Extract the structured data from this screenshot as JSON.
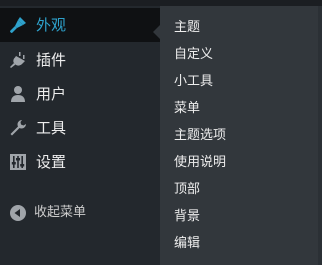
{
  "sidebar": {
    "items": [
      {
        "label": "外观",
        "icon": "paintbrush-icon",
        "current": true
      },
      {
        "label": "插件",
        "icon": "plugin-icon"
      },
      {
        "label": "用户",
        "icon": "user-icon"
      },
      {
        "label": "工具",
        "icon": "wrench-icon"
      },
      {
        "label": "设置",
        "icon": "sliders-icon"
      }
    ],
    "collapse": {
      "label": "收起菜单",
      "icon": "collapse-arrow-icon"
    }
  },
  "submenu": {
    "items": [
      "主题",
      "自定义",
      "小工具",
      "菜单",
      "主题选项",
      "使用说明",
      "顶部",
      "背景",
      "编辑"
    ]
  },
  "colors": {
    "sidebar_bg": "#23282d",
    "submenu_bg": "#32373c",
    "current_bg": "#0f1113",
    "accent": "#2ea2cc",
    "icon": "#a0a5aa"
  }
}
